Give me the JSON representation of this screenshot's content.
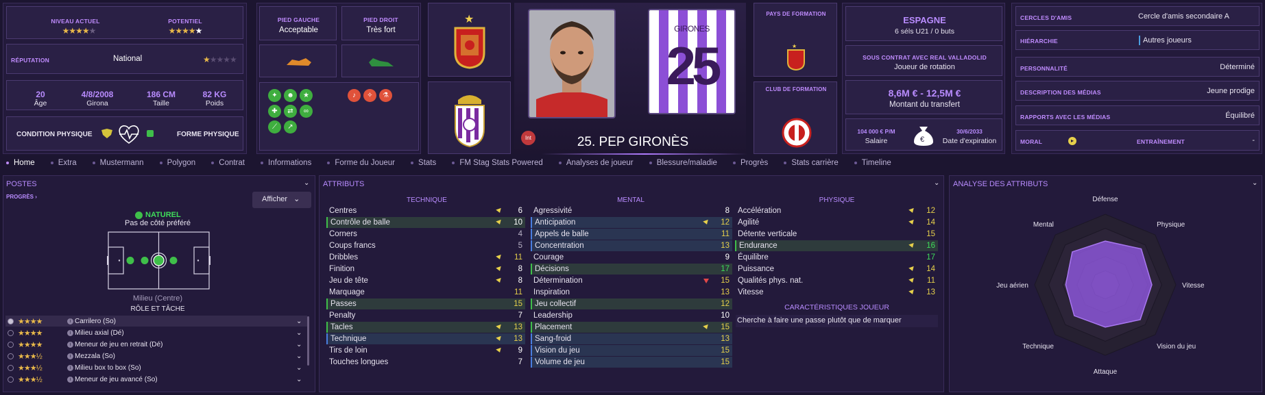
{
  "header": {
    "current_level_label": "NIVEAU ACTUEL",
    "current_level_stars": "★★★★",
    "current_level_empty": "★",
    "potential_label": "POTENTIEL",
    "potential_stars": "★★★★",
    "potential_half": "★",
    "reputation_label": "RÉPUTATION",
    "reputation_value": "National",
    "reputation_stars": "★",
    "reputation_empty": "★★★★",
    "age_value": "20",
    "age_label": "Âge",
    "birth_value": "4/8/2008",
    "birth_place": "Girona",
    "height_value": "186 CM",
    "height_label": "Taille",
    "weight_value": "82 KG",
    "weight_label": "Poids",
    "condition_label": "CONDITION PHYSIQUE",
    "form_label": "FORME PHYSIQUE",
    "left_foot_label": "PIED GAUCHE",
    "left_foot_value": "Acceptable",
    "right_foot_label": "PIED DROIT",
    "right_foot_value": "Très fort",
    "player_number": "25",
    "shirt_name": "GIRONES",
    "player_title": "25. PEP GIRONÈS",
    "injury_badge": "Int",
    "nation_training_label": "PAYS DE FORMATION",
    "club_training_label": "CLUB DE FORMATION",
    "nation": "ESPAGNE",
    "nation_caps": "6 séls U21 / 0 buts",
    "contract_label": "SOUS CONTRAT AVEC REAL VALLADOLID",
    "contract_role": "Joueur de rotation",
    "transfer_value": "8,6M € - 12,5M €",
    "transfer_label": "Montant du transfert",
    "salary_value": "104 000 € P/M",
    "salary_label": "Salaire",
    "expiry_value": "30/6/2033",
    "expiry_label": "Date d'expiration",
    "friends_label": "CERCLES D'AMIS",
    "friends_value": "Cercle d'amis secondaire A",
    "hierarchy_label": "HIÉRARCHIE",
    "hierarchy_value": "Autres joueurs",
    "personality_label": "PERSONNALITÉ",
    "personality_value": "Déterminé",
    "media_desc_label": "DESCRIPTION DES MÉDIAS",
    "media_desc_value": "Jeune prodige",
    "media_rel_label": "RAPPORTS AVEC LES MÉDIAS",
    "media_rel_value": "Équilibré",
    "morale_label": "MORAL",
    "training_label": "ENTRAÎNEMENT",
    "training_value": "-"
  },
  "tabs": [
    "Home",
    "Extra",
    "Mustermann",
    "Polygon",
    "Contrat",
    "Informations",
    "Forme du Joueur",
    "Stats",
    "FM Stag Stats Powered",
    "Analyses de joueur",
    "Blessure/maladie",
    "Progrès",
    "Stats carrière",
    "Timeline"
  ],
  "positions": {
    "title": "POSTES",
    "progress": "PROGRÈS",
    "show_button": "Afficher",
    "natural_label": "NATUREL",
    "preferred_side": "Pas de côté préféré",
    "position_name": "Milieu (Centre)",
    "role_duty_label": "RÔLE ET TÂCHE",
    "roles": [
      {
        "stars": "★★★★",
        "name": "Carrilero (So)"
      },
      {
        "stars": "★★★★",
        "name": "Milieu axial (Dé)"
      },
      {
        "stars": "★★★★",
        "name": "Meneur de jeu en retrait (Dé)"
      },
      {
        "stars": "★★★½",
        "name": "Mezzala (So)"
      },
      {
        "stars": "★★★½",
        "name": "Milieu box to box (So)"
      },
      {
        "stars": "★★★½",
        "name": "Meneur de jeu avancé (So)"
      }
    ]
  },
  "attributes": {
    "title": "ATTRIBUTS",
    "technical_title": "TECHNIQUE",
    "mental_title": "MENTAL",
    "physical_title": "PHYSIQUE",
    "technical": [
      {
        "n": "Centres",
        "v": "6",
        "a": "up",
        "h": ""
      },
      {
        "n": "Contrôle de balle",
        "v": "10",
        "a": "up",
        "h": "g"
      },
      {
        "n": "Corners",
        "v": "4",
        "a": "",
        "h": ""
      },
      {
        "n": "Coups francs",
        "v": "5",
        "a": "",
        "h": ""
      },
      {
        "n": "Dribbles",
        "v": "11",
        "a": "up",
        "h": ""
      },
      {
        "n": "Finition",
        "v": "8",
        "a": "up",
        "h": ""
      },
      {
        "n": "Jeu de tête",
        "v": "8",
        "a": "up",
        "h": ""
      },
      {
        "n": "Marquage",
        "v": "11",
        "a": "",
        "h": ""
      },
      {
        "n": "Passes",
        "v": "15",
        "a": "",
        "h": "g"
      },
      {
        "n": "Penalty",
        "v": "7",
        "a": "",
        "h": ""
      },
      {
        "n": "Tacles",
        "v": "13",
        "a": "up",
        "h": "g"
      },
      {
        "n": "Technique",
        "v": "13",
        "a": "up",
        "h": "b"
      },
      {
        "n": "Tirs de loin",
        "v": "9",
        "a": "up",
        "h": ""
      },
      {
        "n": "Touches longues",
        "v": "7",
        "a": "",
        "h": ""
      }
    ],
    "mental": [
      {
        "n": "Agressivité",
        "v": "8",
        "a": "",
        "h": ""
      },
      {
        "n": "Anticipation",
        "v": "12",
        "a": "up",
        "h": "b"
      },
      {
        "n": "Appels de balle",
        "v": "11",
        "a": "",
        "h": "b"
      },
      {
        "n": "Concentration",
        "v": "13",
        "a": "",
        "h": "b"
      },
      {
        "n": "Courage",
        "v": "9",
        "a": "",
        "h": ""
      },
      {
        "n": "Décisions",
        "v": "17",
        "a": "",
        "h": "g"
      },
      {
        "n": "Détermination",
        "v": "15",
        "a": "down",
        "h": ""
      },
      {
        "n": "Inspiration",
        "v": "13",
        "a": "",
        "h": ""
      },
      {
        "n": "Jeu collectif",
        "v": "12",
        "a": "",
        "h": "g"
      },
      {
        "n": "Leadership",
        "v": "10",
        "a": "",
        "h": ""
      },
      {
        "n": "Placement",
        "v": "15",
        "a": "up",
        "h": "g"
      },
      {
        "n": "Sang-froid",
        "v": "13",
        "a": "",
        "h": "b"
      },
      {
        "n": "Vision du jeu",
        "v": "15",
        "a": "",
        "h": "b"
      },
      {
        "n": "Volume de jeu",
        "v": "15",
        "a": "",
        "h": "b"
      }
    ],
    "physical": [
      {
        "n": "Accélération",
        "v": "12",
        "a": "up",
        "h": ""
      },
      {
        "n": "Agilité",
        "v": "14",
        "a": "up",
        "h": ""
      },
      {
        "n": "Détente verticale",
        "v": "15",
        "a": "",
        "h": ""
      },
      {
        "n": "Endurance",
        "v": "16",
        "a": "up",
        "h": "g"
      },
      {
        "n": "Équilibre",
        "v": "17",
        "a": "",
        "h": ""
      },
      {
        "n": "Puissance",
        "v": "14",
        "a": "up",
        "h": ""
      },
      {
        "n": "Qualités phys. nat.",
        "v": "11",
        "a": "up",
        "h": ""
      },
      {
        "n": "Vitesse",
        "v": "13",
        "a": "up",
        "h": ""
      }
    ],
    "traits_title": "CARACTÉRISTIQUES JOUEUR",
    "trait": "Cherche à faire une passe plutôt que de marquer"
  },
  "analysis": {
    "title": "ANALYSE DES ATTRIBUTS",
    "axes": [
      "Défense",
      "Physique",
      "Vitesse",
      "Vision du jeu",
      "Attaque",
      "Technique",
      "Jeu aérien",
      "Mental"
    ],
    "values": [
      0.62,
      0.72,
      0.66,
      0.7,
      0.6,
      0.62,
      0.56,
      0.66
    ]
  },
  "colors": {
    "accent": "#b98cff",
    "bg": "#1c1530",
    "panel": "#231a3b",
    "radar_fill": "#8a55d6"
  }
}
